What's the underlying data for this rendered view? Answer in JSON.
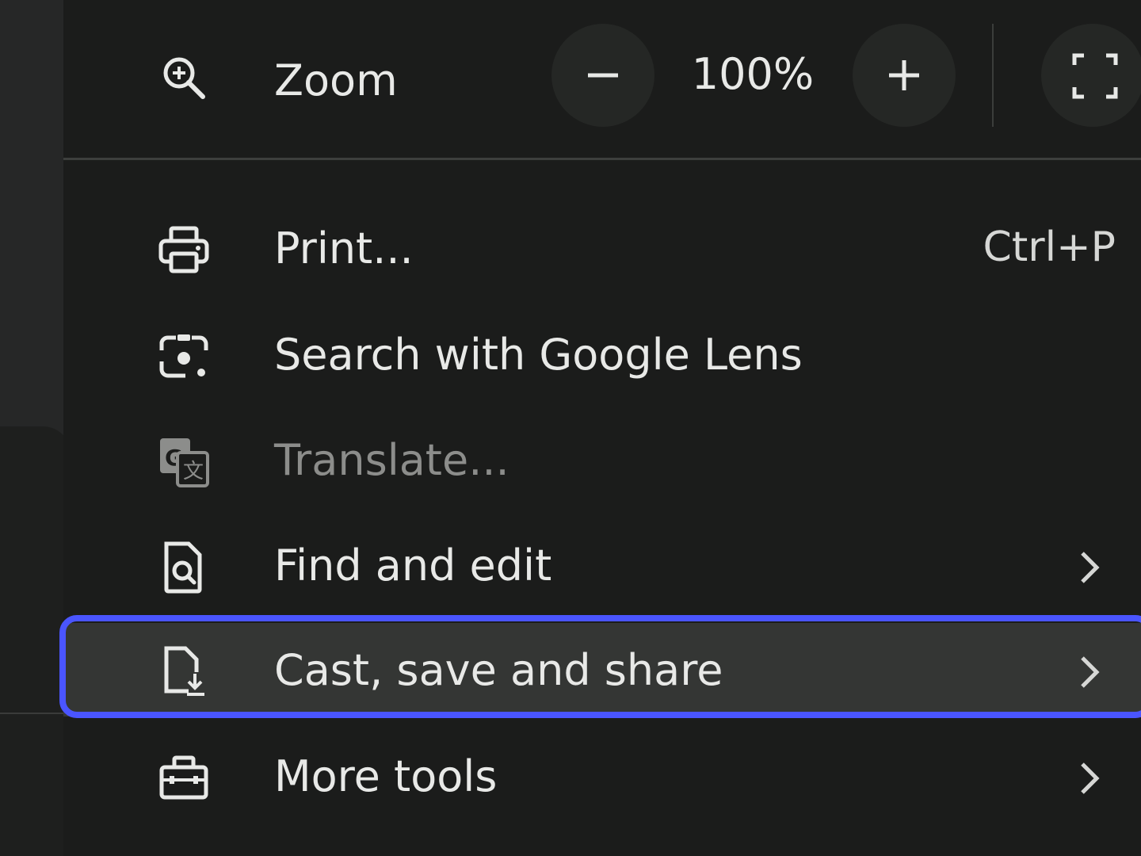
{
  "zoom": {
    "label": "Zoom",
    "value": "100%",
    "decrease_symbol": "minus-icon",
    "increase_symbol": "plus-icon",
    "fullscreen_symbol": "fullscreen-icon"
  },
  "items": [
    {
      "label": "Print...",
      "shortcut": "Ctrl+P",
      "icon": "printer-icon",
      "enabled": true,
      "submenu": false
    },
    {
      "label": "Search with Google Lens",
      "icon": "google-lens-icon",
      "enabled": true,
      "submenu": false
    },
    {
      "label": "Translate...",
      "icon": "translate-icon",
      "enabled": false,
      "submenu": false
    },
    {
      "label": "Find and edit",
      "icon": "find-document-icon",
      "enabled": true,
      "submenu": true
    },
    {
      "label": "Cast, save and share",
      "icon": "save-document-icon",
      "enabled": true,
      "submenu": true,
      "highlighted": true
    },
    {
      "label": "More tools",
      "icon": "toolbox-icon",
      "enabled": true,
      "submenu": true
    }
  ],
  "colors": {
    "menu_background": "#1b1c1b",
    "text": "#e8e9e7",
    "disabled_text": "#8c8d8b",
    "highlight": "#343634",
    "focus_ring": "#4a55ff"
  }
}
